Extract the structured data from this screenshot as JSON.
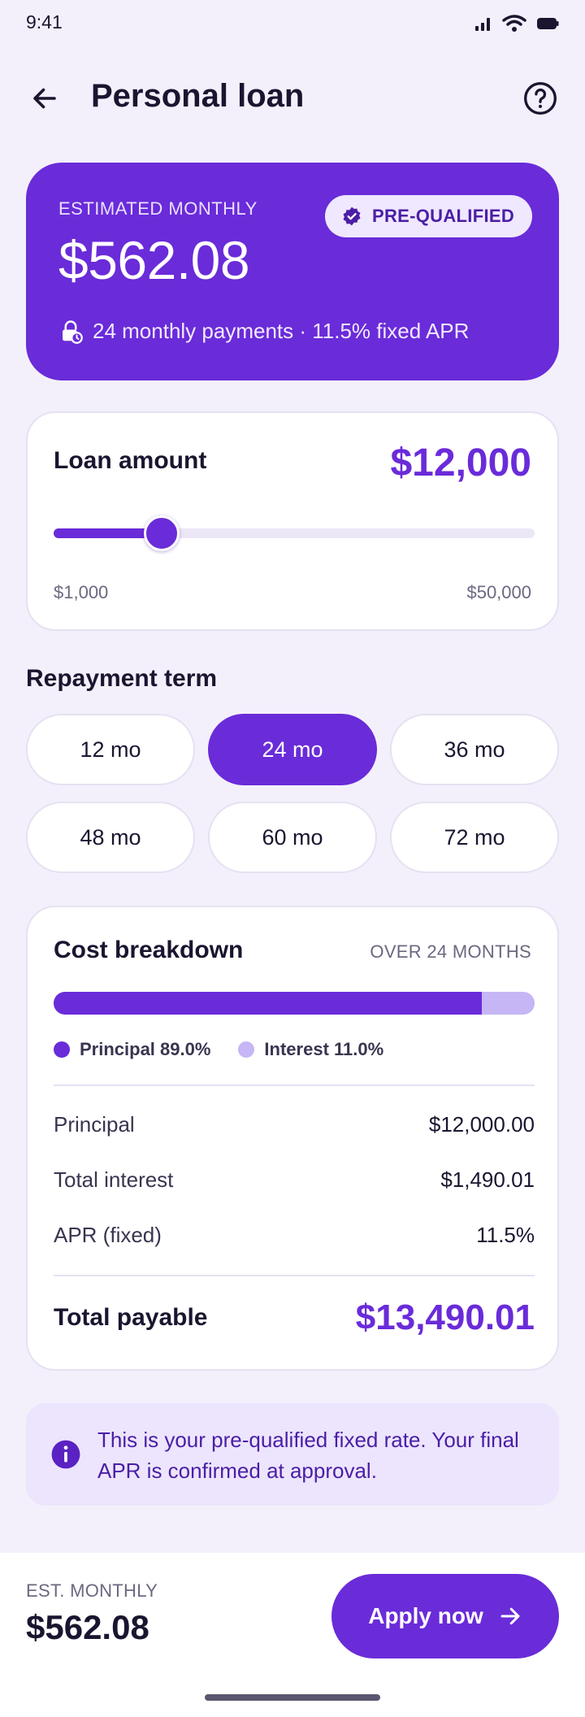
{
  "status_bar": {
    "time": "9:41"
  },
  "app_bar": {
    "title": "Personal loan"
  },
  "hero": {
    "label": "ESTIMATED MONTHLY",
    "amount": "$562.08",
    "badge": "PRE-QUALIFIED",
    "summary": "24 monthly payments · 11.5% fixed APR"
  },
  "loan_amount": {
    "title": "Loan amount",
    "value": "$12,000",
    "min_label": "$1,000",
    "max_label": "$50,000",
    "slider": {
      "min": 1000,
      "max": 50000,
      "value": 12000
    }
  },
  "repayment": {
    "title": "Repayment term",
    "options": [
      "12 mo",
      "24 mo",
      "36 mo",
      "48 mo",
      "60 mo",
      "72 mo"
    ],
    "selected_index": 1
  },
  "cost": {
    "title": "Cost breakdown",
    "period": "OVER 24 MONTHS",
    "principal_share": 0.89,
    "legend_principal": "Principal 89.0%",
    "legend_interest": "Interest 11.0%",
    "rows": [
      {
        "label": "Principal",
        "value": "$12,000.00"
      },
      {
        "label": "Total interest",
        "value": "$1,490.01"
      },
      {
        "label": "APR (fixed)",
        "value": "11.5%"
      }
    ],
    "total_label": "Total payable",
    "total_value": "$13,490.01"
  },
  "info": {
    "text": "This is your pre-qualified fixed rate. Your final APR is confirmed at approval."
  },
  "bottom": {
    "label": "EST. MONTHLY",
    "amount": "$562.08",
    "cta": "Apply now"
  },
  "colors": {
    "accent": "#6A2BD9",
    "accent_light": "#C6B6F5",
    "background": "#F3F0FB",
    "text": "#1B1530"
  },
  "icons": {
    "signal": "signal-icon",
    "wifi": "wifi-icon",
    "battery": "battery-icon",
    "back": "arrow-left-icon",
    "help": "help-circle-icon",
    "verified": "verified-badge-icon",
    "lock": "lock-clock-icon",
    "info": "info-icon",
    "arrow_right": "arrow-right-icon"
  }
}
